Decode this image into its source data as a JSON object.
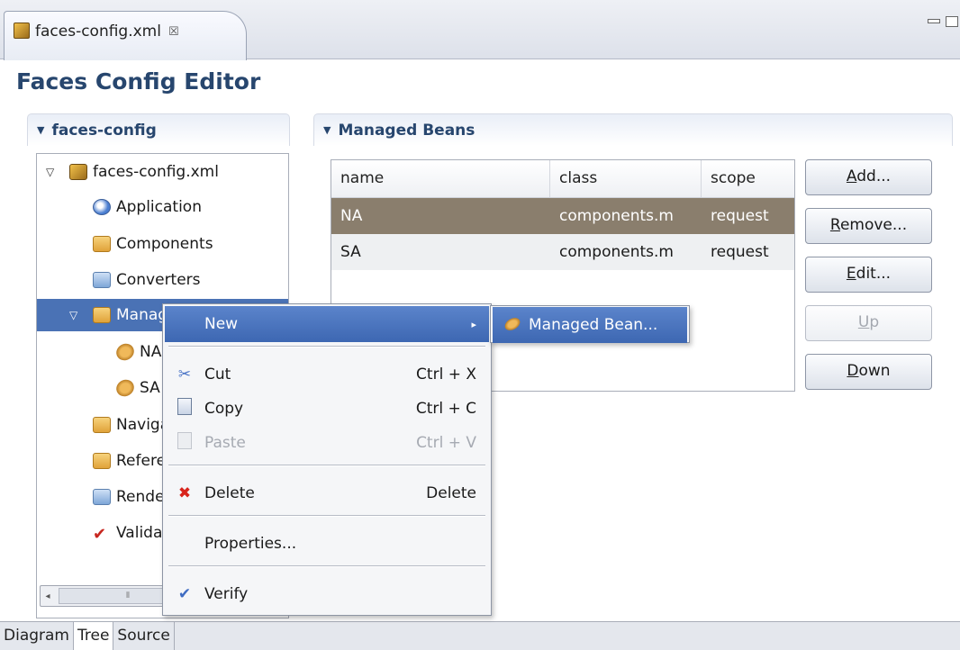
{
  "editor_tab": {
    "label": "faces-config.xml",
    "close": "☒"
  },
  "editor_title": "Faces Config Editor",
  "tree_section": {
    "title": "faces-config"
  },
  "tree": {
    "root": "faces-config.xml",
    "items": [
      "Application",
      "Components",
      "Converters",
      "Managed Beans"
    ],
    "bean_children": [
      "NA",
      "SA"
    ],
    "more_items": [
      "Navigation Rules",
      "Referenced Beans",
      "Render Kits",
      "Validators"
    ]
  },
  "beans_section": {
    "title": "Managed Beans"
  },
  "table": {
    "headers": [
      "name",
      "class",
      "scope"
    ],
    "rows": [
      [
        "NA",
        "components.m",
        "request"
      ],
      [
        "SA",
        "components.m",
        "request"
      ]
    ]
  },
  "buttons": {
    "add": {
      "u": "A",
      "rest": "dd..."
    },
    "remove": {
      "u": "R",
      "rest": "emove..."
    },
    "edit": {
      "u": "E",
      "rest": "dit..."
    },
    "up": {
      "u": "U",
      "rest": "p"
    },
    "down": {
      "u": "D",
      "rest": "own"
    }
  },
  "context_menu": {
    "new": "New",
    "cut": {
      "label": "Cut",
      "shortcut": "Ctrl + X"
    },
    "copy": {
      "label": "Copy",
      "shortcut": "Ctrl + C"
    },
    "paste": {
      "label": "Paste",
      "shortcut": "Ctrl + V"
    },
    "delete": {
      "label": "Delete",
      "shortcut": "Delete"
    },
    "properties": "Properties...",
    "verify": "Verify"
  },
  "submenu": {
    "managed_bean": "Managed Bean..."
  },
  "bottom_tabs": [
    "Diagram",
    "Tree",
    "Source"
  ],
  "colors": {
    "selection": "#4a72b5",
    "table_selection": "#8a7e6d",
    "title": "#27466e"
  }
}
